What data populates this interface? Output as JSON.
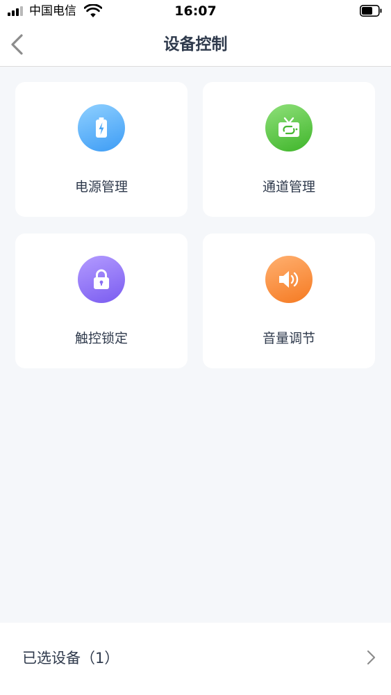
{
  "status_bar": {
    "carrier": "中国电信",
    "time": "16:07"
  },
  "nav": {
    "title": "设备控制",
    "back_icon": "chevron-left-icon"
  },
  "controls": [
    {
      "label": "电源管理",
      "icon": "battery-charging-icon",
      "color": "#3d9cf5"
    },
    {
      "label": "通道管理",
      "icon": "tv-icon",
      "color": "#3fb52a"
    },
    {
      "label": "触控锁定",
      "icon": "lock-icon",
      "color": "#7a5cf0"
    },
    {
      "label": "音量调节",
      "icon": "speaker-icon",
      "color": "#f57a22"
    }
  ],
  "selected_devices": {
    "label": "已选设备（1）",
    "icon": "chevron-right-icon"
  }
}
